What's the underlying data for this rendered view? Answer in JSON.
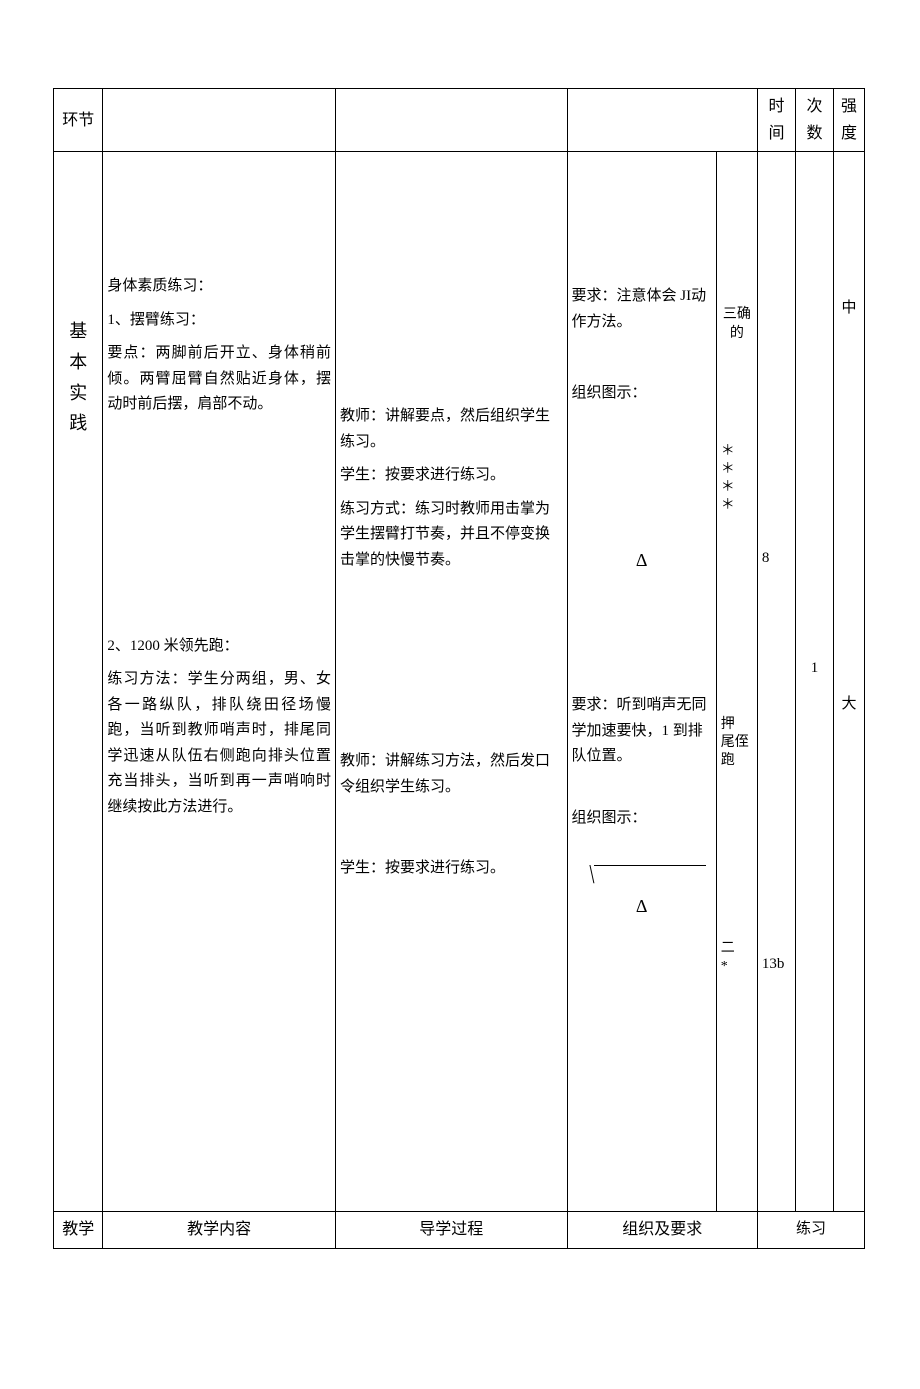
{
  "header": {
    "col_section": "环节",
    "col_time": "时间",
    "col_count": "次数",
    "col_intensity": "强度"
  },
  "section": {
    "char1": "基",
    "char2": "本",
    "char3": "实",
    "char4": "践"
  },
  "content": {
    "block1_title": "身体素质练习：",
    "block1_sub": "1、摆臂练习：",
    "block1_points": "要点：两脚前后开立、身体稍前倾。两臂屈臂自然贴近身体，摆动时前后摆，肩部不动。",
    "block2_title": "2、1200 米领先跑：",
    "block2_method": "练习方法：学生分两组，男、女各一路纵队，排队绕田径场慢跑，当听到教师哨声时，排尾同学迅速从队伍右侧跑向排头位置充当排头，当听到再一声哨响时继续按此方法进行。"
  },
  "process": {
    "p1_teacher": "教师：讲解要点，然后组织学生练习。",
    "p1_student": "学生：按要求进行练习。",
    "p1_mode": "练习方式：练习时教师用击掌为学生摆臂打节奏，并且不停变换击掌的快慢节奏。",
    "p2_teacher": "教师：讲解练习方法，然后发口令组织学生练习。",
    "p2_student": "学生：按要求进行练习。"
  },
  "org": {
    "req1": "要求：注意体会 JI动作方法。",
    "org_title": "组织图示：",
    "delta": "Δ",
    "req2": "要求：听到哨声无同学加速要快，1 到排队位置。",
    "side_sanque": "三确的",
    "stars": "＊\n＊\n＊\n＊",
    "side_yawei": "押　尾侄跑",
    "side_er": "二",
    "side_star": "*"
  },
  "metrics": {
    "time1": "8",
    "time2": "13b",
    "count": "1",
    "intensity1": "中",
    "intensity2": "大"
  },
  "footer": {
    "col1": "教学",
    "col2": "教学内容",
    "col3": "导学过程",
    "col4": "组织及要求",
    "col5": "练习"
  }
}
